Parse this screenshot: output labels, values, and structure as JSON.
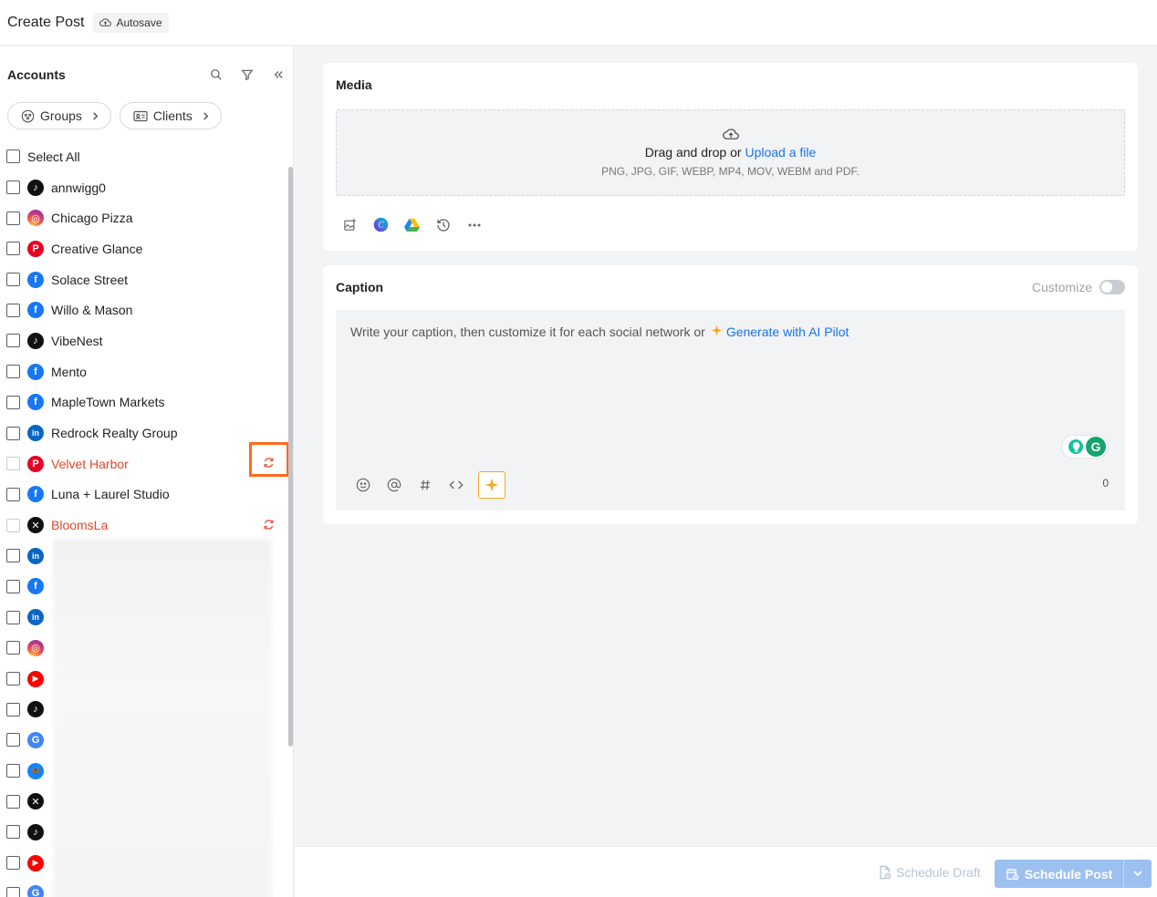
{
  "header": {
    "title": "Create Post",
    "autosave": "Autosave"
  },
  "sidebar": {
    "title": "Accounts",
    "groups_label": "Groups",
    "clients_label": "Clients",
    "select_all": "Select All",
    "accounts": [
      {
        "name": "annwigg0",
        "network": "tiktok",
        "status": "ok"
      },
      {
        "name": "Chicago Pizza",
        "network": "instagram",
        "status": "ok"
      },
      {
        "name": "Creative Glance",
        "network": "pinterest",
        "status": "ok"
      },
      {
        "name": "Solace Street",
        "network": "facebook",
        "status": "ok"
      },
      {
        "name": "Willo & Mason",
        "network": "facebook",
        "status": "ok"
      },
      {
        "name": "VibeNest",
        "network": "tiktok",
        "status": "ok"
      },
      {
        "name": "Mento",
        "network": "facebook",
        "status": "ok"
      },
      {
        "name": "MapleTown Markets",
        "network": "facebook",
        "status": "ok"
      },
      {
        "name": "Redrock Realty Group",
        "network": "linkedin",
        "status": "ok"
      },
      {
        "name": "Velvet Harbor",
        "network": "pinterest",
        "status": "error"
      },
      {
        "name": "Luna + Laurel Studio",
        "network": "facebook",
        "status": "ok"
      },
      {
        "name": "BloomsLa",
        "network": "x",
        "status": "error"
      },
      {
        "name": "",
        "network": "linkedin",
        "status": "ok"
      },
      {
        "name": "",
        "network": "facebook",
        "status": "ok"
      },
      {
        "name": "",
        "network": "linkedin",
        "status": "ok"
      },
      {
        "name": "",
        "network": "instagram",
        "status": "ok"
      },
      {
        "name": "",
        "network": "youtube",
        "status": "ok"
      },
      {
        "name": "",
        "network": "tiktok",
        "status": "ok"
      },
      {
        "name": "",
        "network": "google",
        "status": "ok"
      },
      {
        "name": "",
        "network": "bluesky",
        "status": "ok"
      },
      {
        "name": "",
        "network": "x",
        "status": "ok"
      },
      {
        "name": "",
        "network": "tiktok",
        "status": "ok"
      },
      {
        "name": "",
        "network": "youtube",
        "status": "ok"
      },
      {
        "name": "",
        "network": "google",
        "status": "ok"
      }
    ]
  },
  "media": {
    "title": "Media",
    "drop_text": "Drag and drop or",
    "upload_link": "Upload a file",
    "formats": "PNG, JPG, GIF, WEBP, MP4, MOV, WEBM and PDF.",
    "tools": [
      "image-library-icon",
      "canva-icon",
      "google-drive-icon",
      "history-icon",
      "more-icon"
    ]
  },
  "caption": {
    "title": "Caption",
    "customize_label": "Customize",
    "placeholder": "Write your caption, then customize it for each social network or",
    "ai_link": "Generate with AI Pilot",
    "char_count": "0"
  },
  "footer": {
    "schedule_draft": "Schedule Draft",
    "schedule_post": "Schedule Post"
  },
  "colors": {
    "link": "#1a73e8",
    "error": "#e3462c",
    "highlight": "#ff6b1a",
    "primary_disabled": "#9cc0ef"
  }
}
